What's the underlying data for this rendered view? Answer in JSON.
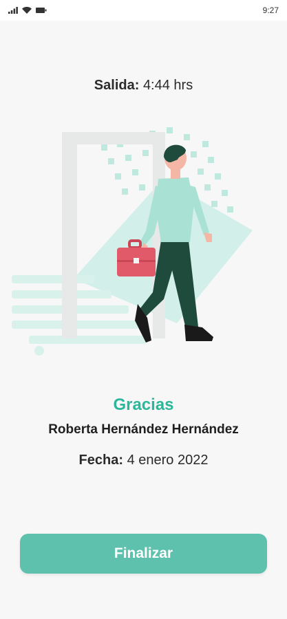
{
  "status_bar": {
    "time": "9:27",
    "icons": [
      "signal-icon",
      "wifi-icon",
      "battery-icon"
    ]
  },
  "exit": {
    "label": "Salida:",
    "value": "4:44 hrs"
  },
  "illustration": {
    "name": "person-leaving-door-illustration",
    "colors": {
      "accent": "#8ad8c8",
      "accent_light": "#cdeee7",
      "door": "#e9eceb",
      "briefcase": "#e05a6a",
      "pants": "#1f4b3d",
      "skin": "#f4b7a5",
      "hair": "#1f4b3d"
    }
  },
  "thanks": {
    "text": "Gracias"
  },
  "person": {
    "name": "Roberta Hernández Hernández"
  },
  "date": {
    "label": "Fecha:",
    "value": "4 enero 2022"
  },
  "actions": {
    "finish_label": "Finalizar"
  },
  "colors": {
    "brand": "#2bb79b",
    "button": "#5ec1ad",
    "background": "#f7f7f7"
  }
}
